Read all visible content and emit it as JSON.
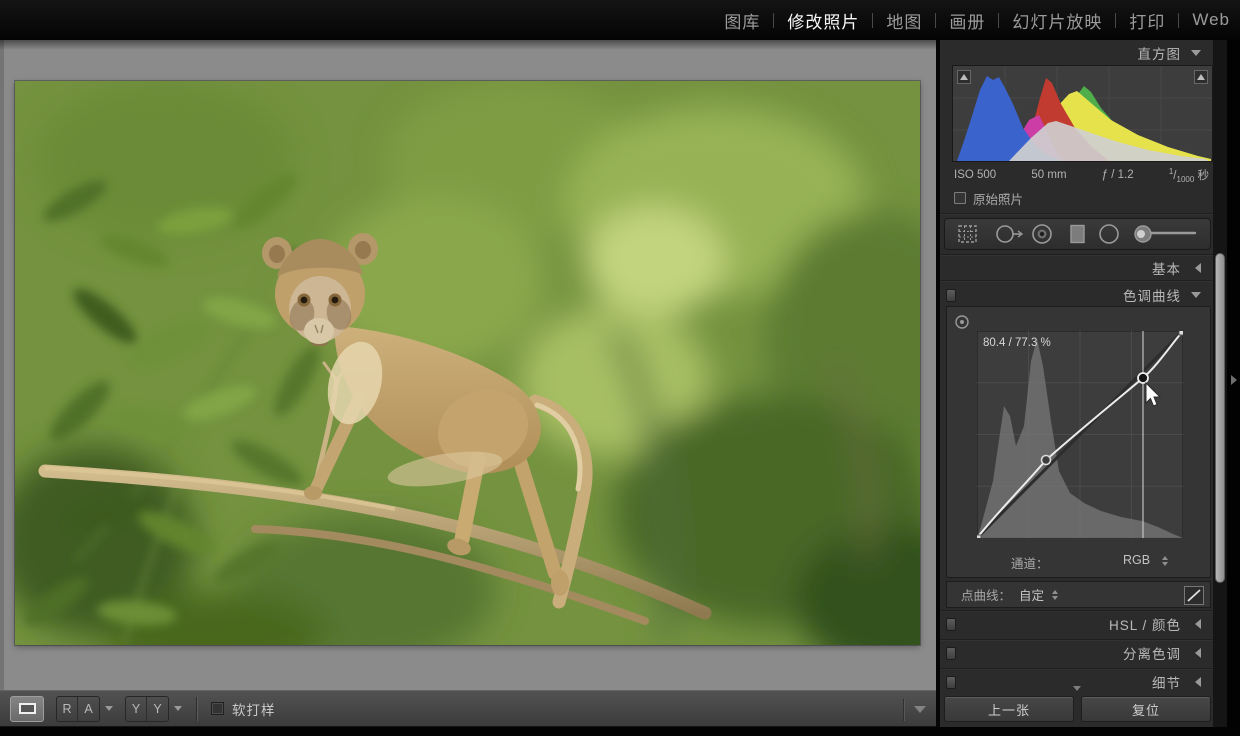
{
  "module_bar": {
    "items": [
      {
        "label": "图库",
        "active": false
      },
      {
        "label": "修改照片",
        "active": true
      },
      {
        "label": "地图",
        "active": false
      },
      {
        "label": "画册",
        "active": false
      },
      {
        "label": "幻灯片放映",
        "active": false
      },
      {
        "label": "打印",
        "active": false
      },
      {
        "label": "Web",
        "active": false
      }
    ]
  },
  "histogram_panel": {
    "title": "直方图",
    "exif": {
      "iso": "ISO 500",
      "focal_length": "50 mm",
      "aperture": "ƒ / 1.2",
      "shutter_numerator": "1",
      "shutter_slash": "/",
      "shutter_denominator": "1000",
      "shutter_unit": "秒"
    },
    "original_photo_label": "原始照片"
  },
  "tool_strip": {
    "tools": [
      "crop-overlay",
      "spot-removal",
      "red-eye-correction",
      "graduated-filter",
      "radial-filter",
      "adjustment-brush"
    ]
  },
  "panels": {
    "basic": "基本",
    "tone_curve": "色调曲线",
    "hsl_color": "HSL / 颜色",
    "split_toning": "分离色调",
    "detail": "细节"
  },
  "tone_curve": {
    "readout": "80.4 / 77.3 %",
    "channel_label": "通道：",
    "channel_value": "RGB",
    "point_curve_label": "点曲线：",
    "point_curve_value": "自定",
    "curve_points_percent": [
      [
        0,
        0
      ],
      [
        33.5,
        37.7
      ],
      [
        80.4,
        77.3
      ],
      [
        100,
        100
      ]
    ]
  },
  "footer": {
    "previous": "上一张",
    "reset": "复位"
  },
  "toolbar": {
    "compare_left": "R",
    "compare_right": "A",
    "before_left": "Y",
    "before_right": "Y",
    "soft_proof_label": "软打样"
  },
  "colors": {
    "active_module_text": "#f8f8f8",
    "panel_bg": "#2b2b2b",
    "canvas_bg": "#8b8b8b",
    "hist_red": "#c23b30",
    "hist_green": "#4fae49",
    "hist_blue": "#3b63cc",
    "hist_yellow": "#e6e24c",
    "hist_magenta": "#cc3da6",
    "hist_gray_overlap": "#d9d9d9"
  }
}
